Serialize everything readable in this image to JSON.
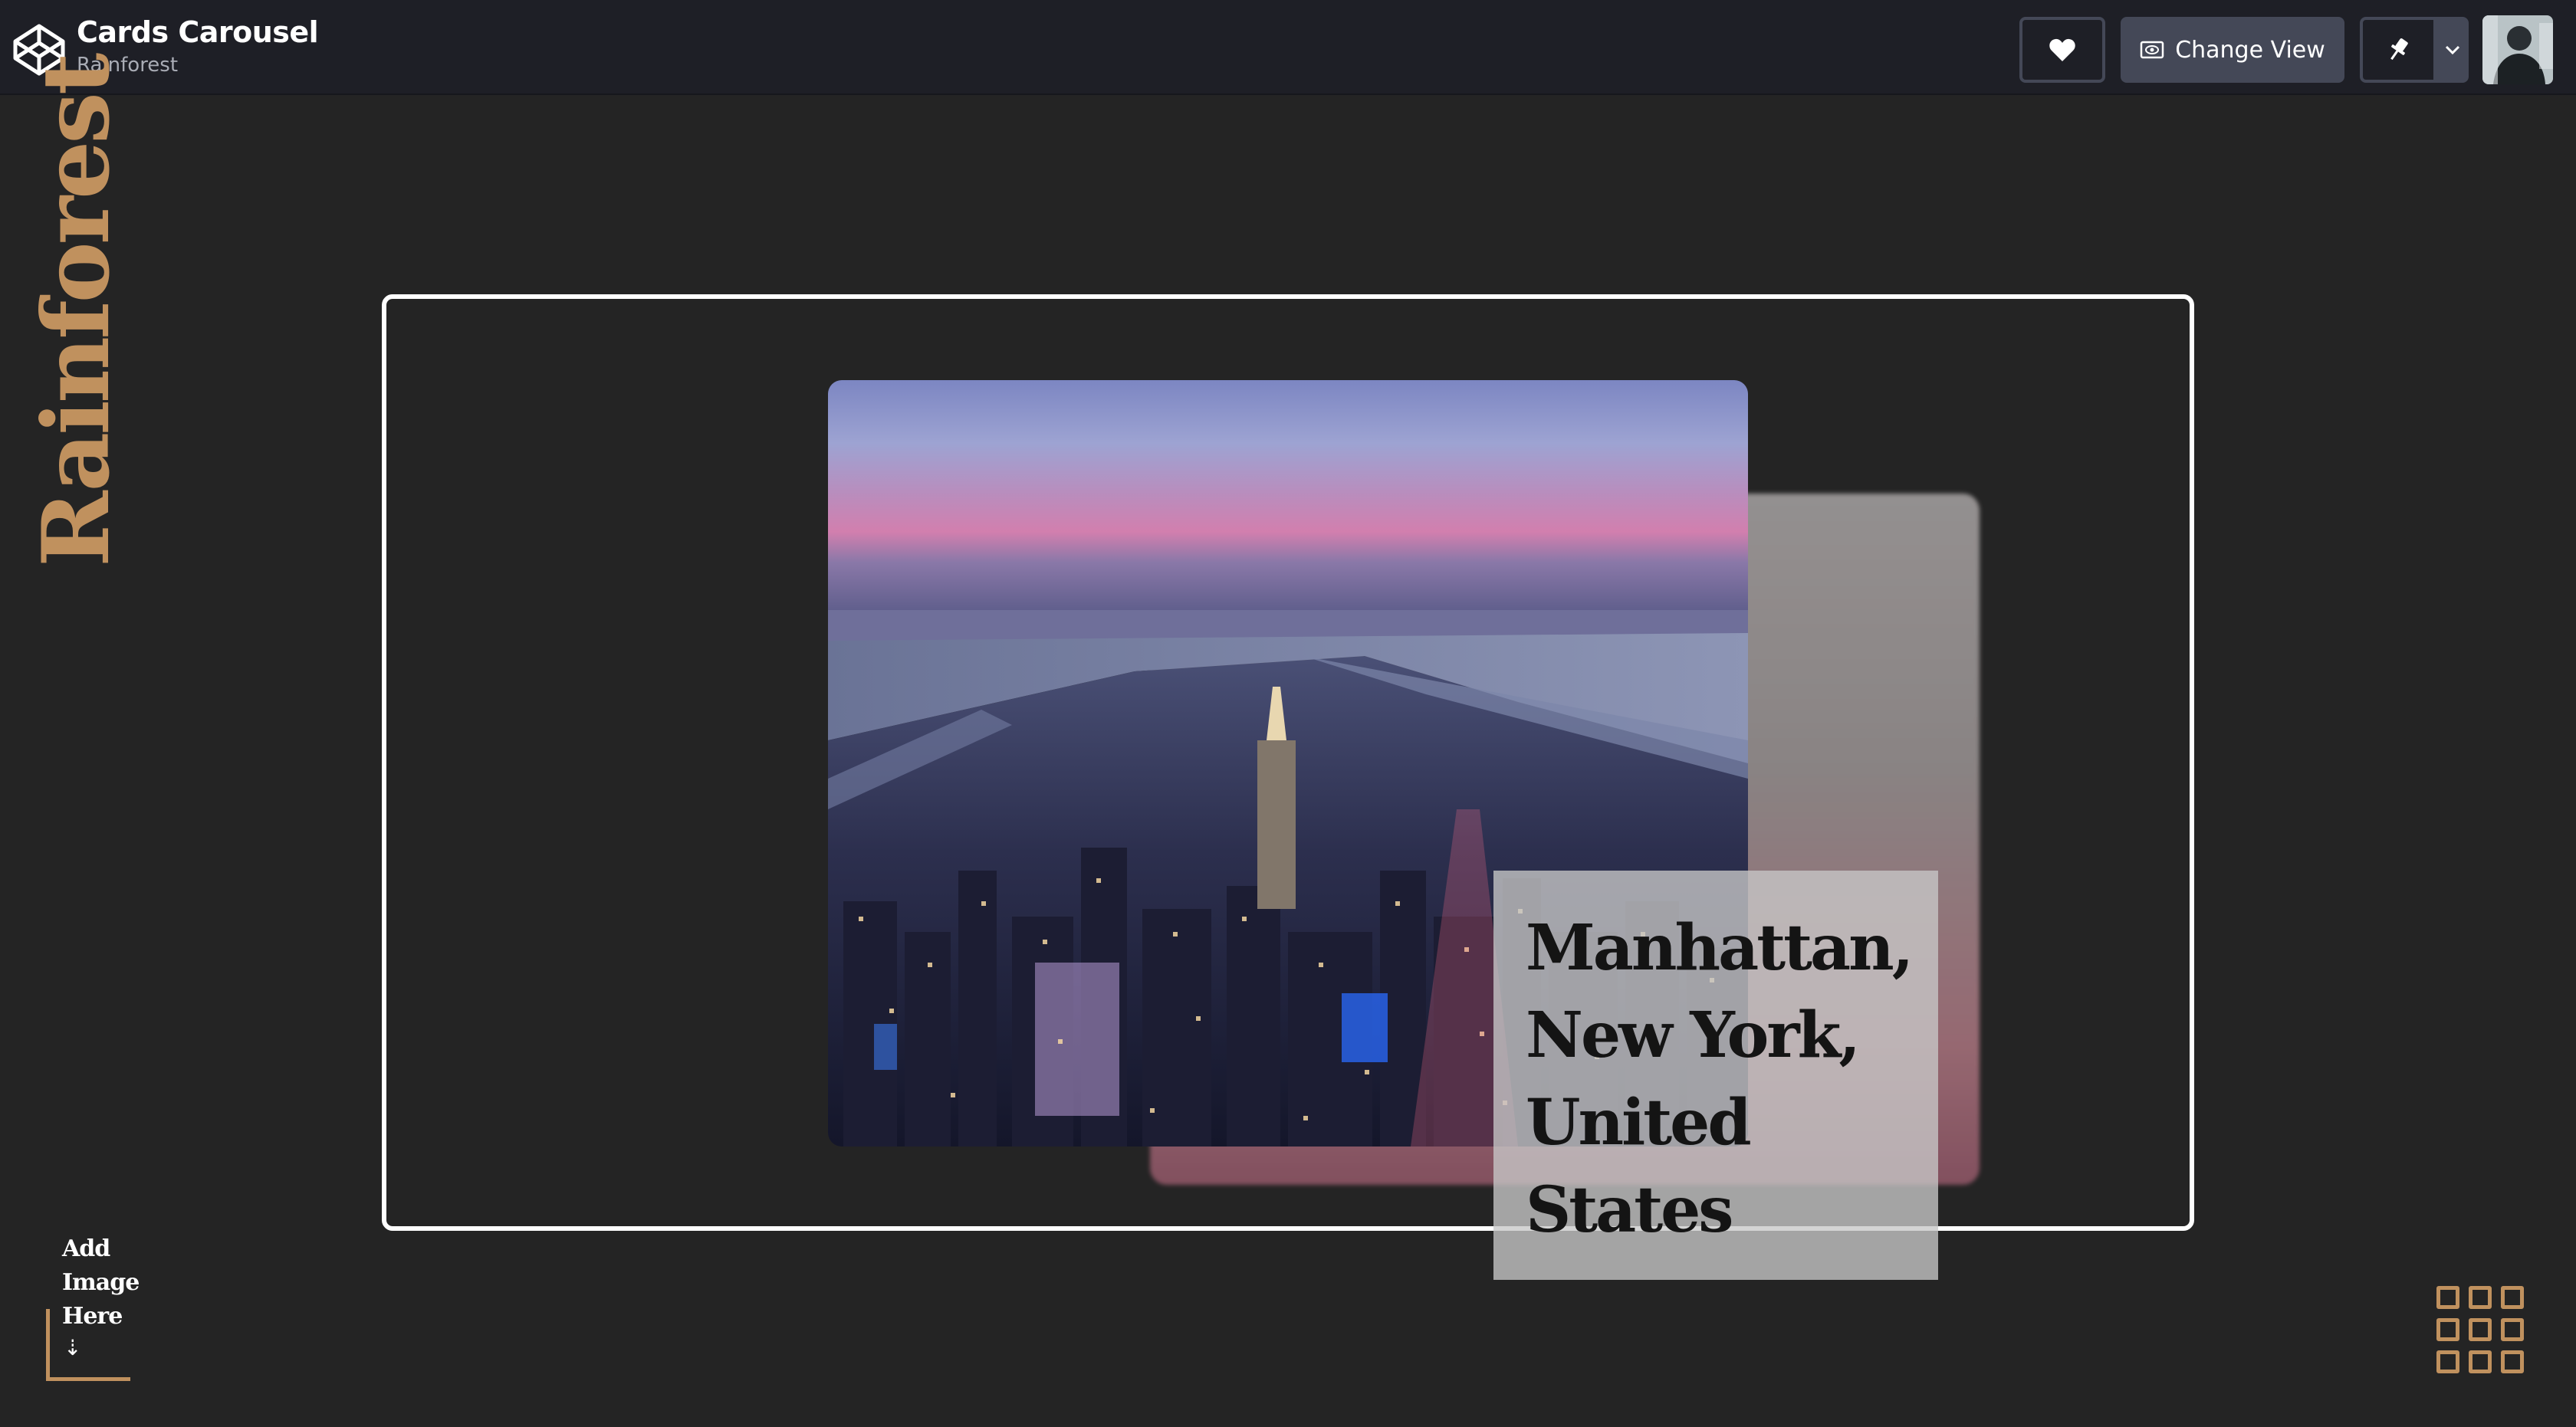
{
  "header": {
    "app_title": "Cards Carousel",
    "app_subtitle": "Rainforest",
    "logo_icon": "codepen-logo-icon",
    "heart_icon": "heart-icon",
    "change_view_label": "Change View",
    "change_view_icon": "eye-icon",
    "pin_icon": "pin-icon",
    "caret_icon": "chevron-down-icon"
  },
  "stage": {
    "side_title": "Rainforest",
    "card": {
      "image_alt": "Aerial view of Manhattan at dusk",
      "caption": "Manhattan, New York, United States"
    },
    "add_image": {
      "line1": "Add",
      "line2": "Image",
      "line3": "Here",
      "arrow": "⇣"
    },
    "grid_icon": "grid-menu-icon"
  },
  "colors": {
    "background": "#242424",
    "topbar": "#1e1f26",
    "accent_gold": "#c0915e",
    "button_gray": "#444857"
  }
}
